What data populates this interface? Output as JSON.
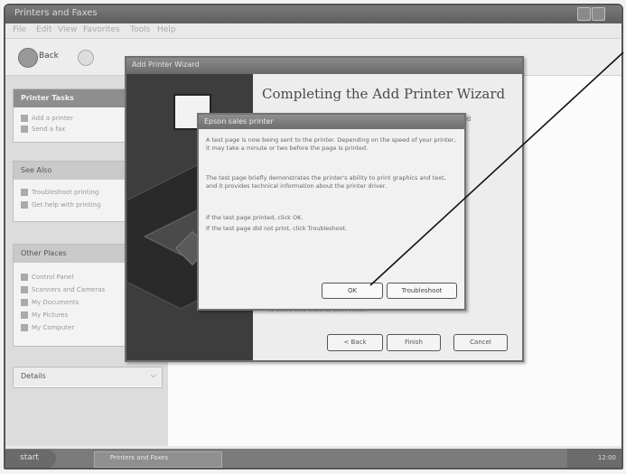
{
  "explorer": {
    "title": "Printers and Faxes",
    "menu": [
      "File",
      "Edit",
      "View",
      "Favorites",
      "Tools",
      "Help"
    ],
    "back_label": "Back"
  },
  "taskpane": {
    "printer_tasks": {
      "title": "Printer Tasks",
      "items": [
        "Add a printer",
        "Send a fax"
      ]
    },
    "see_also": {
      "title": "See Also",
      "items": [
        "Troubleshoot printing",
        "Get help with printing"
      ]
    },
    "other_places": {
      "title": "Other Places",
      "items": [
        "Control Panel",
        "Scanners and Cameras",
        "My Documents",
        "My Pictures",
        "My Computer"
      ]
    },
    "details": {
      "title": "Details"
    }
  },
  "wizard": {
    "title": "Add Printer Wizard",
    "heading": "Completing the Add Printer Wizard",
    "text_stub": "ted",
    "footer": "To close this wizard, click Finish.",
    "back_button": "< Back",
    "finish_button": "Finish",
    "cancel_button": "Cancel"
  },
  "dialog": {
    "title": "Epson sales printer",
    "para1": "A test page is now being sent to the printer. Depending on the speed of your printer, it may take a minute or two before the page is printed.",
    "para2": "The test page briefly demonstrates the printer's ability to print graphics and text, and it provides technical information about the printer driver.",
    "line1": "If the test page printed, click OK.",
    "line2": "If the test page did not print, click Troubleshoot.",
    "ok_button": "OK",
    "troubleshoot_button": "Troubleshoot"
  },
  "taskbar": {
    "start_label": "start",
    "task_label": "Printers and Faxes",
    "clock": "12:00"
  }
}
